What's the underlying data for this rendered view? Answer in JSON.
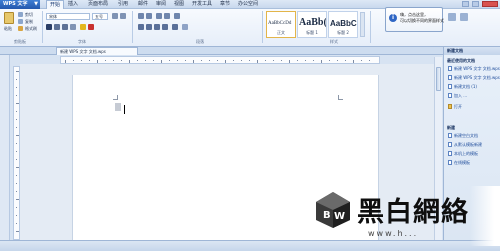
{
  "app": {
    "title": "WPS 文字",
    "caret": "▼"
  },
  "menus": [
    "开始",
    "插入",
    "页面布局",
    "引用",
    "邮件",
    "审阅",
    "视图",
    "开发工具",
    "章节",
    "办公空间"
  ],
  "ribbon": {
    "clipboard": {
      "paste": "粘贴",
      "cut": "剪切",
      "copy": "复制",
      "format_painter": "格式刷",
      "title": "剪贴板"
    },
    "font": {
      "name": "宋体",
      "size": "五号",
      "title": "字体"
    },
    "paragraph": {
      "title": "段落"
    },
    "styles": {
      "title": "样式",
      "tiles": [
        {
          "sample": "AaBbCcDd",
          "caption": "正文"
        },
        {
          "sample": "AaBb(",
          "caption": "标题 1"
        },
        {
          "sample": "AaBbC",
          "caption": "标题 2"
        }
      ]
    }
  },
  "tooltip": {
    "line1": "嗨，点击这里，",
    "line2": "可以切换不同的界面样式",
    "line3": ""
  },
  "document": {
    "tab_label": "新建 WPS 文字 文档.wps"
  },
  "taskpane": {
    "header": "新建文档",
    "recent_title": "最近使用的文档",
    "recent_items": [
      "新建 WPS 文字 文档.wps",
      "新建 WPS 文字 文档.wps",
      "新建文档 (1)",
      "加入 ...",
      "打开"
    ],
    "new_title": "新建",
    "new_items": [
      "新建空白文档",
      "从默认模板新建",
      "本机上的模板",
      "在线模板"
    ]
  },
  "watermark": {
    "text": "黑白網絡",
    "url": "www.h..."
  }
}
